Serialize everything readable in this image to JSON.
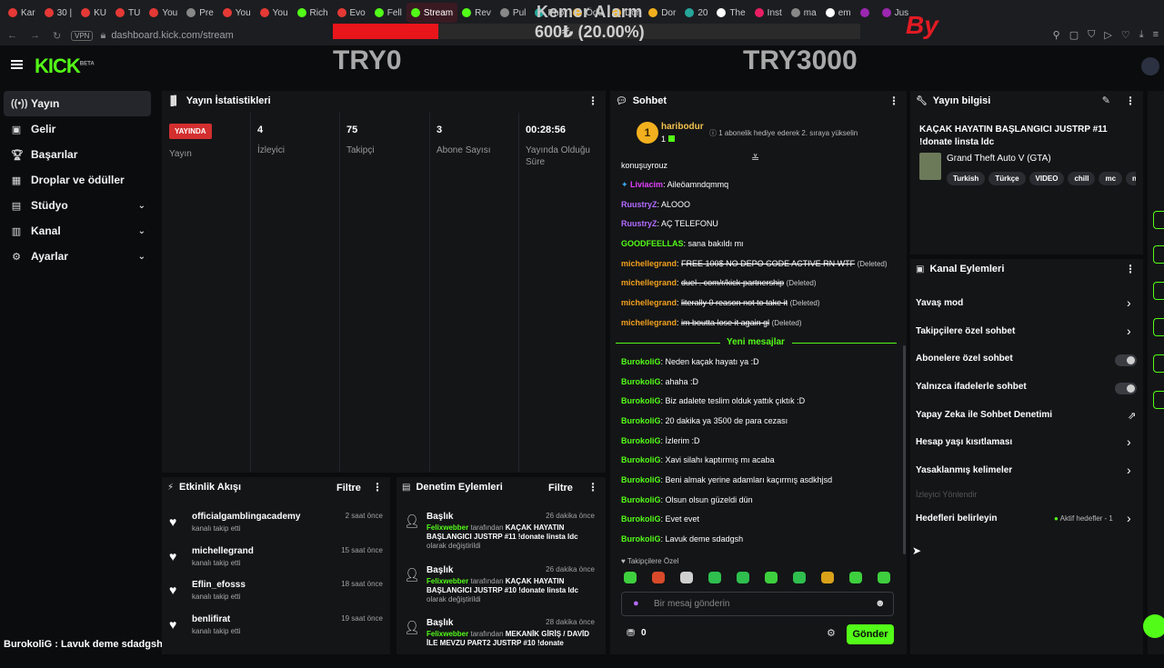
{
  "browser": {
    "tabs": [
      {
        "label": "Kar",
        "color": "#e53935"
      },
      {
        "label": "30 |",
        "color": "#e53935"
      },
      {
        "label": "KU",
        "color": "#e53935"
      },
      {
        "label": "TU",
        "color": "#e53935"
      },
      {
        "label": "You",
        "color": "#e53935"
      },
      {
        "label": "Pre",
        "color": "#888888"
      },
      {
        "label": "You",
        "color": "#e53935"
      },
      {
        "label": "You",
        "color": "#e53935"
      },
      {
        "label": "Rich",
        "color": "#53fc18"
      },
      {
        "label": "Evo",
        "color": "#e53935"
      },
      {
        "label": "Fell",
        "color": "#53fc18"
      },
      {
        "label": "Stream",
        "color": "#53fc18",
        "active": true
      },
      {
        "label": "Rev",
        "color": "#53fc18"
      },
      {
        "label": "Pul",
        "color": "#888888"
      },
      {
        "label": "Pho",
        "color": "#26a69a"
      },
      {
        "label": "Ödü",
        "color": "#f2b01e"
      },
      {
        "label": "Dor",
        "color": "#f2b01e"
      },
      {
        "label": "Dor",
        "color": "#f2b01e"
      },
      {
        "label": "20",
        "color": "#26a69a"
      },
      {
        "label": "The",
        "color": "#ffffff"
      },
      {
        "label": "Inst",
        "color": "#e91e63"
      },
      {
        "label": "ma",
        "color": "#888888"
      },
      {
        "label": "em",
        "color": "#ffffff"
      },
      {
        "label": "",
        "color": "#9c27b0"
      },
      {
        "label": "Jus",
        "color": "#9c27b0"
      }
    ],
    "vpn": "VPN",
    "url": "dashboard.kick.com/stream"
  },
  "overlay": {
    "title": "Kemer Alarm",
    "amount": "600₺ (20.00%)",
    "progress": 0.2,
    "left_label": "TRY0",
    "right_label": "TRY3000",
    "logo_text": "By"
  },
  "header": {
    "logo": "KICK",
    "logo_badge": "BETA"
  },
  "sidebar": {
    "items": [
      {
        "label": "Yayın",
        "icon": "broadcast-icon",
        "glyph": "((•))",
        "active": true
      },
      {
        "label": "Gelir",
        "icon": "wallet-icon",
        "glyph": "▣"
      },
      {
        "label": "Başarılar",
        "icon": "trophy-icon",
        "glyph": "🏆︎"
      },
      {
        "label": "Droplar ve ödüller",
        "icon": "gift-icon",
        "glyph": "▦"
      },
      {
        "label": "Stüdyo",
        "icon": "studio-icon",
        "glyph": "▤",
        "chevron": true
      },
      {
        "label": "Kanal",
        "icon": "channel-icon",
        "glyph": "▥",
        "chevron": true
      },
      {
        "label": "Ayarlar",
        "icon": "gear-icon",
        "glyph": "⚙",
        "chevron": true
      }
    ]
  },
  "stats": {
    "title": "Yayın İstatistikleri",
    "live_badge": "YAYINDA",
    "cols": [
      {
        "value": "",
        "label": "Yayın"
      },
      {
        "value": "4",
        "label": "İzleyici"
      },
      {
        "value": "75",
        "label": "Takipçi"
      },
      {
        "value": "3",
        "label": "Abone Sayısı"
      },
      {
        "value": "00:28:56",
        "label": "Yayında Olduğu Süre"
      }
    ]
  },
  "activity": {
    "title": "Etkinlik Akışı",
    "filter": "Filtre",
    "items": [
      {
        "name": "officialgamblingacademy",
        "sub": "kanalı takip etti",
        "time": "2 saat önce"
      },
      {
        "name": "michellegrand",
        "sub": "kanalı takip etti",
        "time": "15 saat önce"
      },
      {
        "name": "Eflin_efosss",
        "sub": "kanalı takip etti",
        "time": "18 saat önce"
      },
      {
        "name": "benlifirat",
        "sub": "kanalı takip etti",
        "time": "19 saat önce"
      }
    ]
  },
  "moderation": {
    "title": "Denetim Eylemleri",
    "filter": "Filtre",
    "items": [
      {
        "title": "Başlık",
        "time": "26 dakika önce",
        "user": "Felixwebber",
        "mid": "tarafından",
        "value": "KAÇAK HAYATIN BAŞLANGICI JUSTRP #11 !donate linsta ldc",
        "tail": "olarak değiştirildi"
      },
      {
        "title": "Başlık",
        "time": "26 dakika önce",
        "user": "Felixwebber",
        "mid": "tarafından",
        "value": "KAÇAK HAYATIN BAŞLANGICI JUSTRP #10 !donate linsta ldc",
        "tail": "olarak değiştirildi"
      },
      {
        "title": "Başlık",
        "time": "28 dakika önce",
        "user": "Felixwebber",
        "mid": "tarafından",
        "value": "MEKANİK GİRİŞ / DAVİD İLE MEVZU PART2 JUSTRP #10 !donate",
        "tail": ""
      }
    ]
  },
  "chat": {
    "title": "Sohbet",
    "pinned_user": "haribodur",
    "pinned_count": "1",
    "pinned_badge": "1",
    "pinned_info": "1 abonelik hediye ederek 2. sıraya yükselin",
    "messages": [
      {
        "user": "",
        "text": "konuşuyrouz",
        "color": "#ffffff"
      },
      {
        "user": "Liviacim",
        "text": "Aileöamndqmmq",
        "color": "#e040fb",
        "badge": true
      },
      {
        "user": "RuustryZ",
        "text": "ALOOO",
        "color": "#b36bff"
      },
      {
        "user": "RuustryZ",
        "text": "AÇ TELEFONU",
        "color": "#b36bff"
      },
      {
        "user": "GOODFEELLAS",
        "text": "sana bakıldı mı",
        "color": "#53fc18"
      },
      {
        "user": "michellegrand",
        "text": "FREE 100$ NO DEPO CODE ACTIVE RN WTF",
        "color": "#f2a11e",
        "deleted": true
      },
      {
        "user": "michellegrand",
        "text": "duel . com/r/kick-partnership",
        "color": "#f2a11e",
        "deleted": true
      },
      {
        "user": "michellegrand",
        "text": "literally 0 reason not to take it",
        "color": "#f2a11e",
        "deleted": true
      },
      {
        "user": "michellegrand",
        "text": "im boutta lose it again gl",
        "color": "#f2a11e",
        "deleted": true
      },
      {
        "user": "BurokoliG",
        "text": "Neden kaçak hayatı ya :D",
        "color": "#53fc18"
      },
      {
        "user": "BurokoliG",
        "text": "ahaha :D",
        "color": "#53fc18"
      },
      {
        "user": "BurokoliG",
        "text": "Biz adalete teslim olduk yattık çıktık :D",
        "color": "#53fc18"
      },
      {
        "user": "BurokoliG",
        "text": "20 dakika ya 3500 de para cezası",
        "color": "#53fc18"
      },
      {
        "user": "BurokoliG",
        "text": "İzlerim :D",
        "color": "#53fc18"
      },
      {
        "user": "BurokoliG",
        "text": "Xavi silahı kaptırmış mı acaba",
        "color": "#53fc18"
      },
      {
        "user": "BurokoliG",
        "text": "Beni almak yerine adamları kaçırmış asdkhjsd",
        "color": "#53fc18"
      },
      {
        "user": "BurokoliG",
        "text": "Olsun olsun güzeldi dün",
        "color": "#53fc18"
      },
      {
        "user": "BurokoliG",
        "text": "Evet evet",
        "color": "#53fc18"
      },
      {
        "user": "BurokoliG",
        "text": "Lavuk deme sdadgsh",
        "color": "#53fc18"
      }
    ],
    "deleted_tag": "(Deleted)",
    "new_messages": "Yeni mesajlar",
    "followers_only": "Takipçilere Özel",
    "input_placeholder": "Bir mesaj gönderin",
    "points": "0",
    "send": "Gönder",
    "emote_colors": [
      "#3ecf3e",
      "#d84a2a",
      "#cfcfcf",
      "#2fbf4f",
      "#2fbf4f",
      "#3ecf3e",
      "#2fbf4f",
      "#d9a21a",
      "#3ecf3e",
      "#3ecf3e"
    ]
  },
  "stream_info": {
    "title": "Yayın bilgisi",
    "stream_title": "KAÇAK HAYATIN BAŞLANGICI JUSTRP #11 !donate linsta ldc",
    "category": "Grand Theft Auto V (GTA)",
    "tags": [
      "Turkish",
      "Türkçe",
      "VIDEO",
      "chill",
      "mc",
      "n"
    ]
  },
  "channel_actions": {
    "title": "Kanal Eylemleri",
    "items": [
      {
        "label": "Yavaş mod",
        "kind": "chevron"
      },
      {
        "label": "Takipçilere özel sohbet",
        "kind": "chevron"
      },
      {
        "label": "Abonelere özel sohbet",
        "kind": "toggle"
      },
      {
        "label": "Yalnızca ifadelerle sohbet",
        "kind": "toggle"
      },
      {
        "label": "Yapay Zeka ile Sohbet Denetimi",
        "kind": "external"
      },
      {
        "label": "Hesap yaşı kısıtlaması",
        "kind": "chevron"
      },
      {
        "label": "Yasaklanmış kelimeler",
        "kind": "chevron"
      }
    ],
    "section_label": "İzleyici Yönlendir",
    "targets_label": "Hedefleri belirleyin",
    "targets_status": "Aktif hedefler - 1"
  },
  "bottom_chat": "BurokoliG : Lavuk deme sdadgsh"
}
